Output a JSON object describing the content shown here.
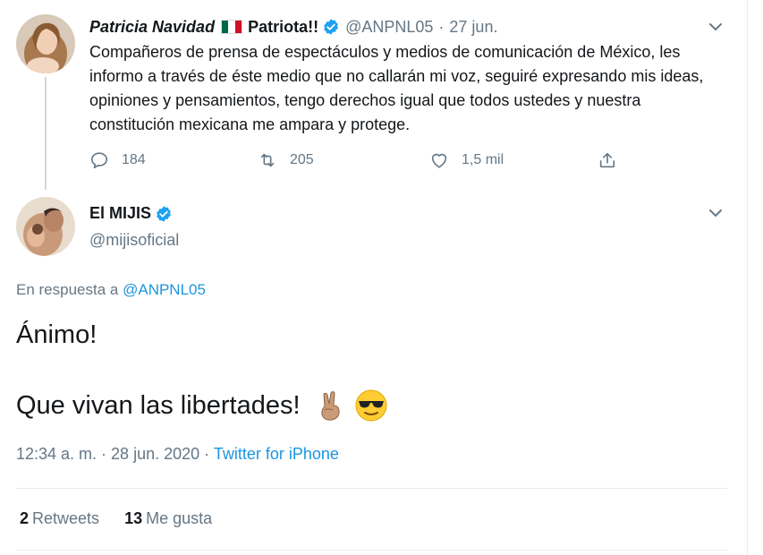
{
  "parent_tweet": {
    "name": "Patricia Navidad",
    "flag_icon": "mexico-flag",
    "name_suffix": "Patriota!!",
    "handle": "@ANPNL05",
    "separator": "·",
    "date": "27 jun.",
    "text": "Compañeros de prensa de espectáculos y medios de comunicación de México, les informo a través de éste medio que no callarán mi voz, seguiré expresando mis ideas, opiniones y pensamientos, tengo derechos igual que todos ustedes y nuestra constitución mexicana me ampara y protege.",
    "actions": {
      "replies": "184",
      "retweets": "205",
      "likes": "1,5 mil"
    }
  },
  "main_tweet": {
    "name": "El MIJIS",
    "handle": "@mijisoficial",
    "reply_prefix": "En respuesta a",
    "reply_to": "@ANPNL05",
    "line1": "Ánimo!",
    "line2": "Que vivan las libertades!",
    "emojis": [
      "victory-hand-icon",
      "sunglasses-face-icon"
    ],
    "timestamp": "12:34 a. m. · 28 jun. 2020 · ",
    "source": "Twitter for iPhone",
    "stats": {
      "retweets_count": "2",
      "retweets_label": "Retweets",
      "likes_count": "13",
      "likes_label": "Me gusta"
    }
  },
  "colors": {
    "accent": "#1b95e0",
    "verified": "#1da1f2",
    "muted": "#657786",
    "text": "#14171a"
  }
}
